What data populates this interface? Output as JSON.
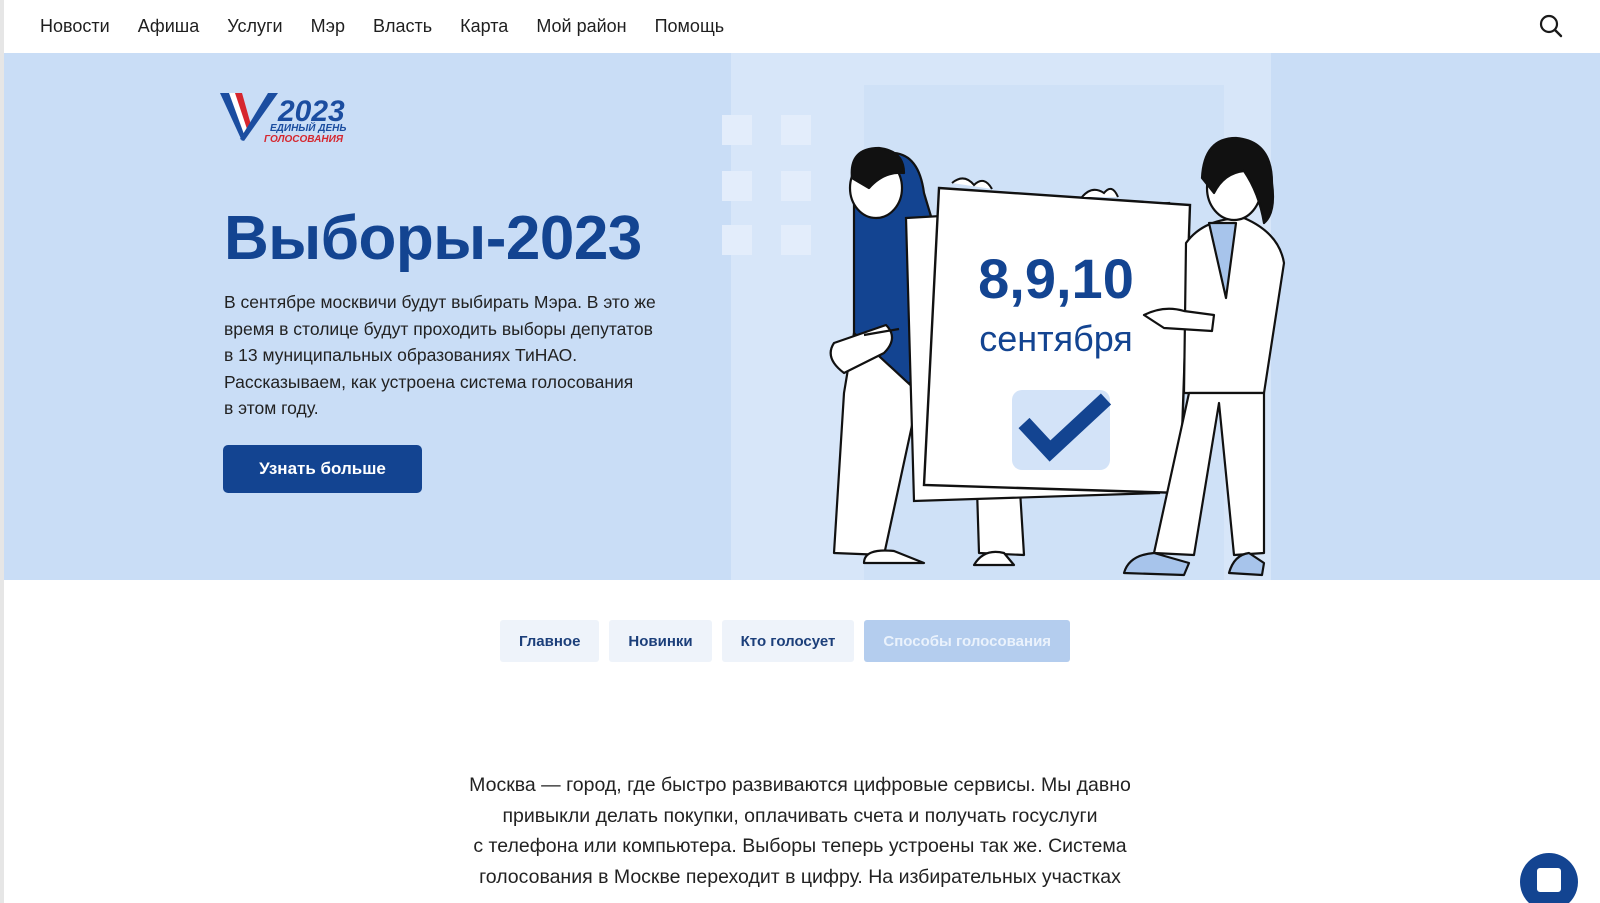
{
  "nav": {
    "items": [
      "Новости",
      "Афиша",
      "Услуги",
      "Мэр",
      "Власть",
      "Карта",
      "Мой район",
      "Помощь"
    ],
    "search_icon": "search-icon"
  },
  "hero": {
    "logo": {
      "year": "2023",
      "line1": "ЕДИНЫЙ ДЕНЬ",
      "line2": "ГОЛОСОВАНИЯ"
    },
    "title": "Выборы-2023",
    "text_lines": [
      "В сентябре москвичи будут выбирать Мэра. В это же",
      "время в столице будут проходить выборы депутатов",
      "в 13 муниципальных образованиях ТиНАО.",
      "Рассказываем, как устроена система голосования",
      "в этом году."
    ],
    "button_label": "Узнать больше",
    "poster_dates": "8,9,10",
    "poster_month": "сентября"
  },
  "tabs": [
    {
      "label": "Главное",
      "active": false
    },
    {
      "label": "Новинки",
      "active": false
    },
    {
      "label": "Кто голосует",
      "active": false
    },
    {
      "label": "Способы голосования",
      "active": true
    }
  ],
  "article": {
    "lines": [
      "Москва — город, где быстро развиваются цифровые сервисы. Мы давно",
      "привыкли делать покупки, оплачивать счета и получать госуслуги",
      "с телефона или компьютера. Выборы теперь устроены так же. Система",
      "голосования в Москве переходит в цифру. На избирательных участках"
    ]
  },
  "colors": {
    "brand": "#134491",
    "hero_bg": "#c9ddf6",
    "tab_bg": "#eef3fa",
    "tab_active": "#b4cdee"
  }
}
